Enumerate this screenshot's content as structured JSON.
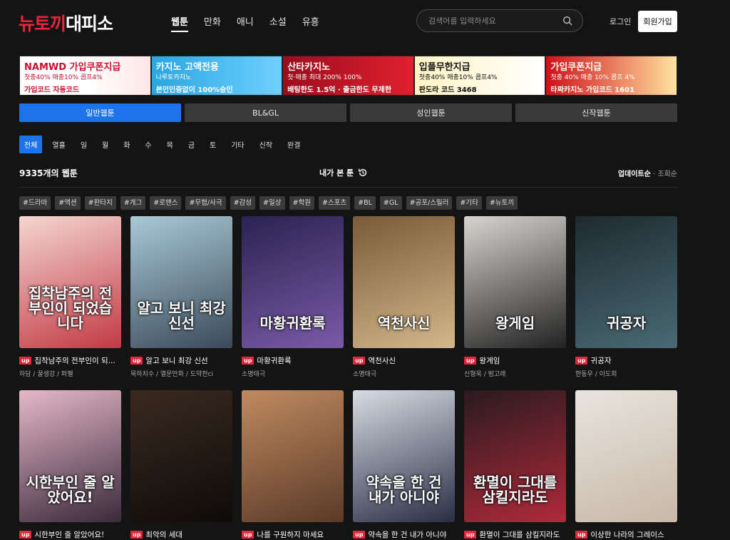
{
  "header": {
    "logo_part1": "뉴토끼",
    "logo_part2": "대피소",
    "nav": [
      "웹툰",
      "만화",
      "애니",
      "소설",
      "유흥"
    ],
    "search_placeholder": "검색어를 입력하세요",
    "login_label": "로그인",
    "signup_label": "회원가입",
    "search_icon": "search-icon"
  },
  "banners": [
    {
      "line1": "NAMWD 가입쿠폰지급",
      "line2": "첫충40% 매충10% 콤프4%",
      "line3": "가입코드 자동코드"
    },
    {
      "line1": "카지노 고액전용",
      "line2": "나루토카지노",
      "line3": "본인인증없이 100%승인"
    },
    {
      "line1": "산타카지노",
      "line2": "첫·매충 최대 200% 100%",
      "line3": "배팅한도 1.5억 · 출금한도 무제한"
    },
    {
      "line1": "입플무한지급",
      "line2": "첫충40% 매충10% 콤프4%",
      "line3": "판도라 코드 3468"
    },
    {
      "line1": "가입쿠폰지급",
      "line2": "첫충 40% 매충 10% 콤프 4%",
      "line3": "타짜카지노 가입코드 1601"
    }
  ],
  "category_tabs": [
    "일반웹툰",
    "BL&GL",
    "성인웹툰",
    "신작웹툰"
  ],
  "day_tabs": [
    "전체",
    "열흘",
    "일",
    "월",
    "화",
    "수",
    "목",
    "금",
    "토",
    "기타",
    "신작",
    "완결"
  ],
  "list": {
    "count_label": "9335개의 웹툰",
    "recent_label": "내가 본 툰",
    "sort_update": "업데이트순",
    "sort_sep": "·",
    "sort_views": "조회순"
  },
  "tags": [
    "#드라마",
    "#액션",
    "#판타지",
    "#개그",
    "#로맨스",
    "#무협/사극",
    "#감성",
    "#일상",
    "#학원",
    "#스포츠",
    "#BL",
    "#GL",
    "#공포/스릴러",
    "#기타",
    "#뉴토끼"
  ],
  "badge": "up",
  "webtoons": [
    {
      "title": "집착남주의 전부인이 되...",
      "author": "하담 / 꿀생강 / 퍼펠",
      "cover_text": "집착남주의 전부인이 되었습니다",
      "colors": [
        "#f4d6d2",
        "#c23a44"
      ]
    },
    {
      "title": "알고 보니 최강 신선",
      "author": "묵하치수 / 열문만화 / 도약천ci",
      "cover_text": "알고 보니 최강 신선",
      "colors": [
        "#a9c9d8",
        "#3b4a58"
      ]
    },
    {
      "title": "마황귀환록",
      "author": "소명태극",
      "cover_text": "마황귀환록",
      "colors": [
        "#2a2350",
        "#7a5aa8"
      ]
    },
    {
      "title": "역천사신",
      "author": "소명태극",
      "cover_text": "역천사신",
      "colors": [
        "#7a5a38",
        "#d2b88a"
      ]
    },
    {
      "title": "왕게임",
      "author": "신형욱 / 범고래",
      "cover_text": "왕게임",
      "colors": [
        "#d8d4d0",
        "#222"
      ]
    },
    {
      "title": "귀공자",
      "author": "한동우 / 이도희",
      "cover_text": "귀공자",
      "colors": [
        "#1e2a30",
        "#4a6a74"
      ]
    },
    {
      "title": "시한부인 줄 알았어요!",
      "author": "",
      "cover_text": "시한부인 줄 알았어요!",
      "colors": [
        "#e6b8c8",
        "#3a2a3a"
      ]
    },
    {
      "title": "최악의 세대",
      "author": "",
      "cover_text": "",
      "colors": [
        "#3a2a20",
        "#0e0b0a"
      ]
    },
    {
      "title": "나를 구원하지 마세요",
      "author": "",
      "cover_text": "",
      "colors": [
        "#c08a60",
        "#5a3a28"
      ]
    },
    {
      "title": "약속을 한 건 내가 아니야",
      "author": "",
      "cover_text": "약속을 한 건 내가 아니야",
      "colors": [
        "#d8dce4",
        "#2a2e44"
      ]
    },
    {
      "title": "환멸이 그대를 삼킬지라도",
      "author": "",
      "cover_text": "환멸이 그대를 삼킬지라도",
      "colors": [
        "#2a1a20",
        "#b02a3a"
      ]
    },
    {
      "title": "이상한 나라의 그레이스",
      "author": "",
      "cover_text": "",
      "colors": [
        "#e8e4de",
        "#c8b8a8"
      ]
    }
  ]
}
